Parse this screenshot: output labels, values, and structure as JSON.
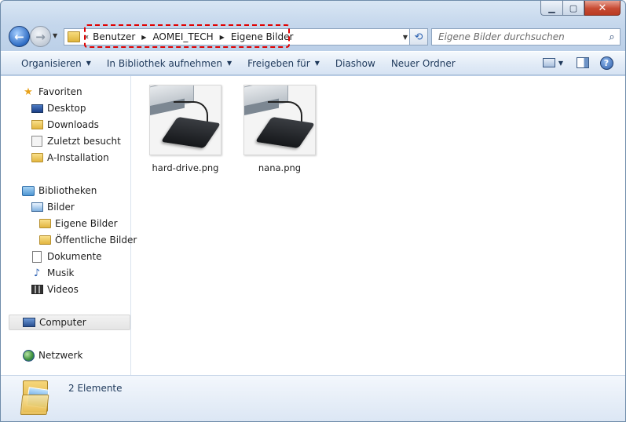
{
  "window": {
    "caption": {
      "minimize": "▁",
      "maximize": "▢",
      "close": "✕"
    }
  },
  "nav": {
    "breadcrumb": [
      "Benutzer",
      "AOMEI_TECH",
      "Eigene Bilder"
    ],
    "search_placeholder": "Eigene Bilder durchsuchen"
  },
  "toolbar": {
    "organize": "Organisieren",
    "include_library": "In Bibliothek aufnehmen",
    "share": "Freigeben für",
    "slideshow": "Diashow",
    "new_folder": "Neuer Ordner",
    "help": "?"
  },
  "sidebar": {
    "favorites": {
      "label": "Favoriten",
      "items": [
        "Desktop",
        "Downloads",
        "Zuletzt besucht",
        "A-Installation"
      ]
    },
    "libraries": {
      "label": "Bibliotheken",
      "pictures": "Bilder",
      "pictures_children": [
        "Eigene Bilder",
        "Öffentliche Bilder"
      ],
      "other": [
        "Dokumente",
        "Musik",
        "Videos"
      ]
    },
    "computer": "Computer",
    "network": "Netzwerk"
  },
  "files": [
    {
      "name": "hard-drive.png"
    },
    {
      "name": "nana.png"
    }
  ],
  "details": {
    "count": "2 Elemente"
  },
  "colors": {
    "accent": "#1e395b",
    "highlight_border": "#e00000"
  }
}
